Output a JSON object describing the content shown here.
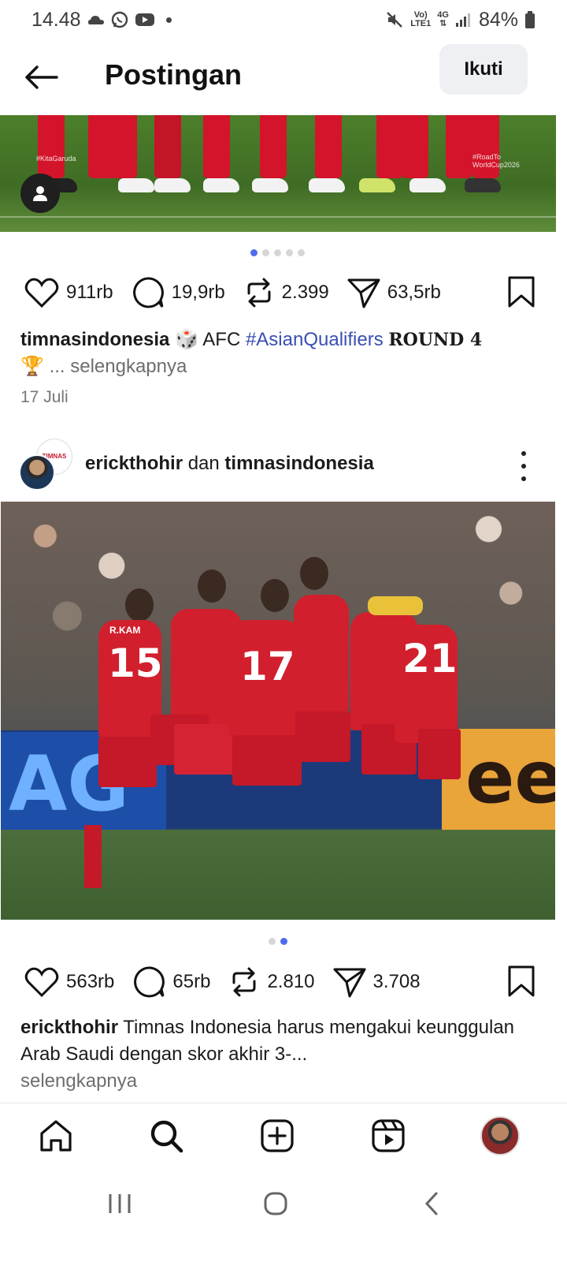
{
  "status_bar": {
    "time": "14.48",
    "network_top": "Vo)",
    "network_bottom": "LTE1",
    "signal_top": "4G",
    "battery": "84%"
  },
  "header": {
    "title": "Postingan",
    "follow_label": "Ikuti"
  },
  "post1": {
    "image_text_left": "#KitaGaruda",
    "image_text_right": "#RoadTo WorldCup2026",
    "likes": "911rb",
    "comments": "19,9rb",
    "reposts": "2.399",
    "shares": "63,5rb",
    "username": "timnasindonesia",
    "dice": "🎲",
    "caption_text": "AFC",
    "hashtag": "#AsianQualifiers",
    "caption_round": "𝐑𝐎𝐔𝐍𝐃 𝟒",
    "trophy": "🏆",
    "more_label": "... selengkapnya",
    "date": "17 Juli",
    "carousel_total": 5,
    "carousel_active": 1
  },
  "post2": {
    "user1": "erickthohir",
    "joiner": "dan",
    "user2": "timnasindonesia",
    "avatar_back_text": "TIMNAS",
    "image": {
      "ad_left": "AG",
      "ad_right": "ee",
      "jersey_name": "R.KAM",
      "numbers": [
        "15",
        "17",
        "21"
      ]
    },
    "likes": "563rb",
    "comments": "65rb",
    "reposts": "2.810",
    "shares": "3.708",
    "caption_user": "erickthohir",
    "caption_text": "Timnas Indonesia harus mengakui keunggulan Arab Saudi dengan skor akhir 3-...",
    "more_label": "selengkapnya",
    "carousel_total": 2,
    "carousel_active": 2
  },
  "bottom_nav": {
    "items": [
      "home-icon",
      "search-icon",
      "create-icon",
      "reels-icon",
      "profile-avatar"
    ]
  },
  "colors": {
    "accent_dot": "#4e6bf0",
    "hashtag": "#3a4fb0",
    "follow_bg": "#eef0f3"
  }
}
